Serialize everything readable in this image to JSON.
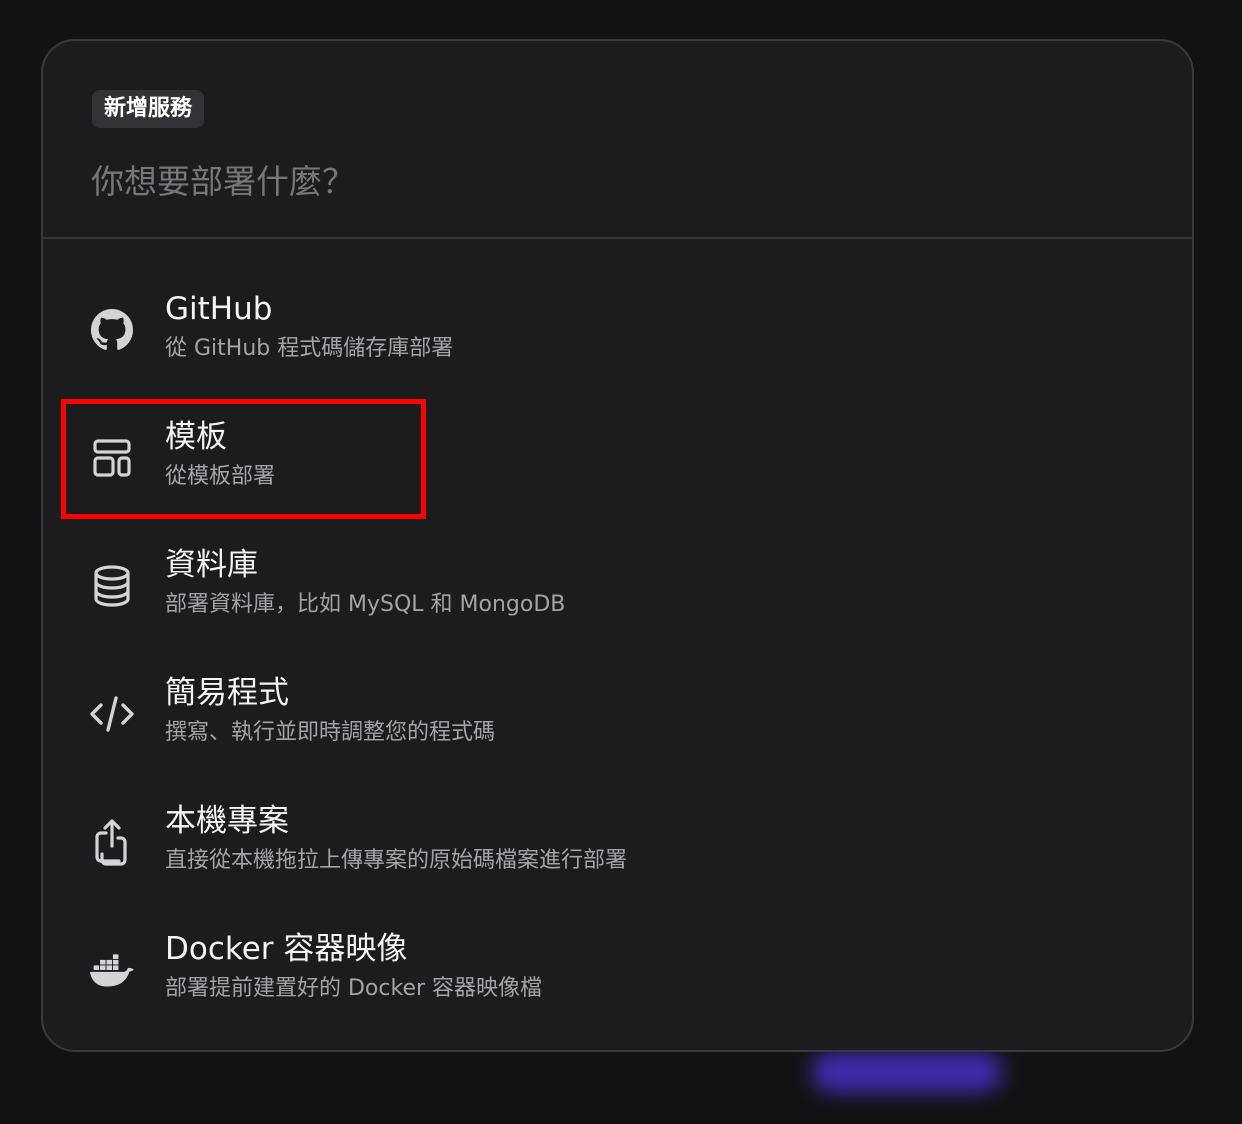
{
  "dialog": {
    "badge": "新增服務",
    "search_placeholder": "你想要部署什麼？"
  },
  "options": [
    {
      "icon": "github-icon",
      "title": "GitHub",
      "description": "從 GitHub 程式碼儲存庫部署"
    },
    {
      "icon": "template-layout-icon",
      "title": "模板",
      "description": "從模板部署"
    },
    {
      "icon": "database-icon",
      "title": "資料庫",
      "description": "部署資料庫，比如 MySQL 和 MongoDB"
    },
    {
      "icon": "code-icon",
      "title": "簡易程式",
      "description": "撰寫、執行並即時調整您的程式碼"
    },
    {
      "icon": "upload-icon",
      "title": "本機專案",
      "description": "直接從本機拖拉上傳專案的原始碼檔案進行部署"
    },
    {
      "icon": "docker-icon",
      "title": "Docker 容器映像",
      "description": "部署提前建置好的 Docker 容器映像檔"
    }
  ],
  "colors": {
    "background": "#121214",
    "dialog_background": "#1c1c1f",
    "highlight": "#ff0000",
    "accent_glow": "#4a2fc8"
  }
}
